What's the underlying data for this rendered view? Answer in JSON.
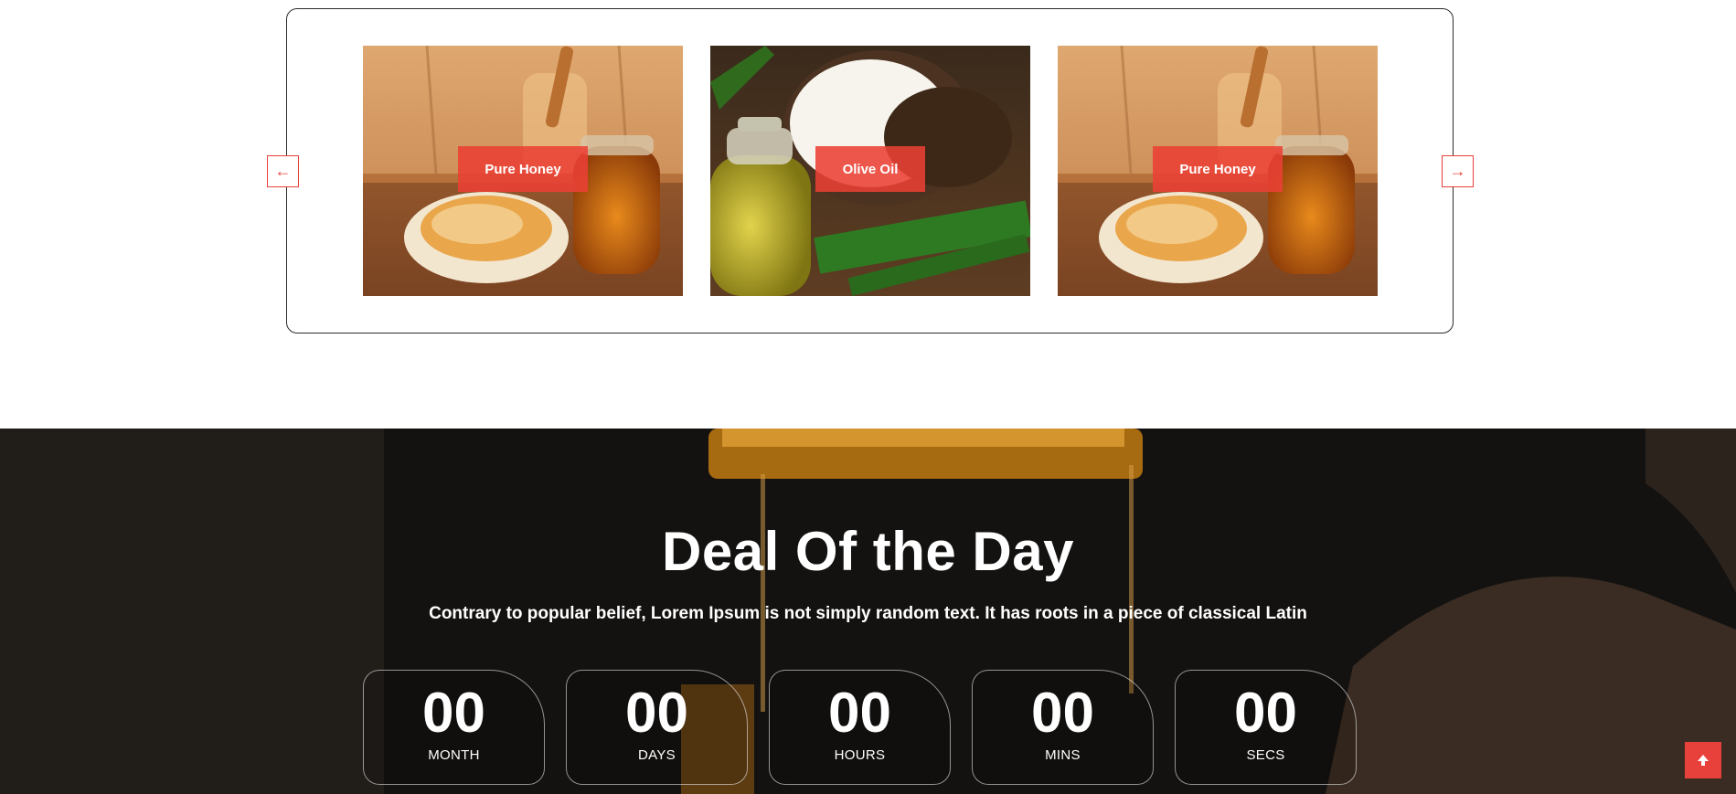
{
  "carousel": {
    "prev_icon": "←",
    "next_icon": "→",
    "items": [
      {
        "label": "Pure Honey",
        "image": "honey-jars-icon"
      },
      {
        "label": "Olive Oil",
        "image": "coconut-oil-icon"
      },
      {
        "label": "Pure Honey",
        "image": "honey-jars-icon"
      }
    ]
  },
  "deal": {
    "title": "Deal Of the Day",
    "subtitle": "Contrary to popular belief, Lorem Ipsum is not simply random text. It has roots in a piece of classical Latin",
    "countdown": [
      {
        "value": "00",
        "label": "MONTH"
      },
      {
        "value": "00",
        "label": "DAYS"
      },
      {
        "value": "00",
        "label": "HOURS"
      },
      {
        "value": "00",
        "label": "MINS"
      },
      {
        "value": "00",
        "label": "SECS"
      }
    ]
  },
  "scroll_top_icon": "arrow-up-icon",
  "colors": {
    "accent": "#e8403a",
    "deal_bg": "#161412"
  }
}
